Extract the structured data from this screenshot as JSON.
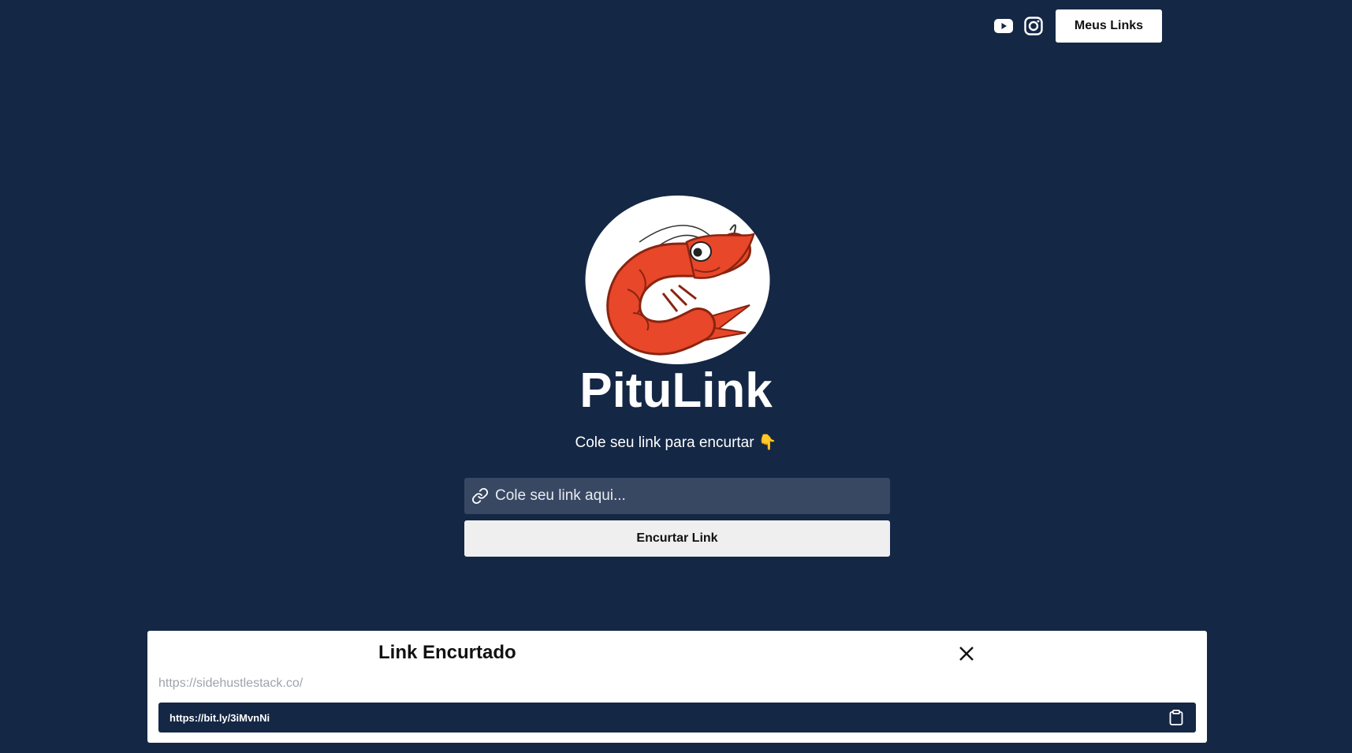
{
  "header": {
    "social_icons": [
      "youtube-icon",
      "instagram-icon"
    ],
    "my_links_label": "Meus Links"
  },
  "hero": {
    "logo": "shrimp-logo",
    "title": "PituLink",
    "subtitle": "Cole seu link para encurtar 👇"
  },
  "form": {
    "input_placeholder": "Cole seu link aqui...",
    "input_value": "",
    "submit_label": "Encurtar Link"
  },
  "modal": {
    "title": "Link Encurtado",
    "original_url": "https://sidehustlestack.co/",
    "short_url": "https://bit.ly/3iMvnNi"
  },
  "colors": {
    "background": "#142745",
    "input_bg": "#384863",
    "shrimp": "#e8472a"
  }
}
